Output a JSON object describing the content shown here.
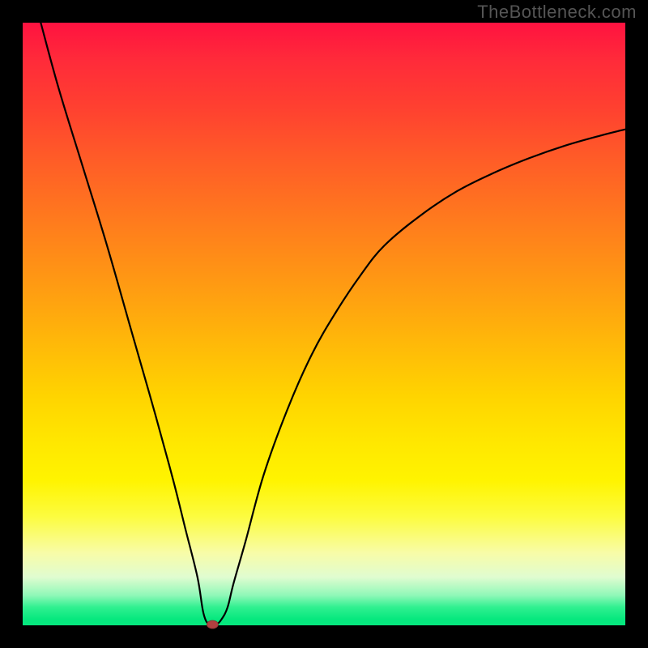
{
  "watermark": "TheBottleneck.com",
  "chart_data": {
    "type": "line",
    "title": "",
    "xlabel": "",
    "ylabel": "",
    "xlim": [
      0,
      100
    ],
    "ylim": [
      0,
      100
    ],
    "background_gradient": {
      "top": "#ff1240",
      "midtop": "#ffb000",
      "mid": "#fff400",
      "bottom": "#06e87e"
    },
    "series": [
      {
        "name": "bottleneck-curve",
        "x": [
          3,
          6,
          10,
          14,
          18,
          22,
          25,
          27,
          29,
          30,
          31,
          32,
          33,
          34,
          35,
          37,
          40,
          44,
          48,
          52,
          56,
          60,
          66,
          72,
          78,
          84,
          90,
          96,
          100
        ],
        "y": [
          100,
          89,
          76,
          63,
          49,
          35,
          24,
          16,
          8,
          2,
          0,
          0,
          1,
          3,
          7,
          14,
          25,
          36,
          45,
          52,
          58,
          63,
          68,
          72,
          75,
          77.5,
          79.6,
          81.3,
          82.3
        ]
      }
    ],
    "minimum_marker": {
      "x": 31.5,
      "y": 0
    },
    "marker_color": "#b04040",
    "annotations": []
  }
}
